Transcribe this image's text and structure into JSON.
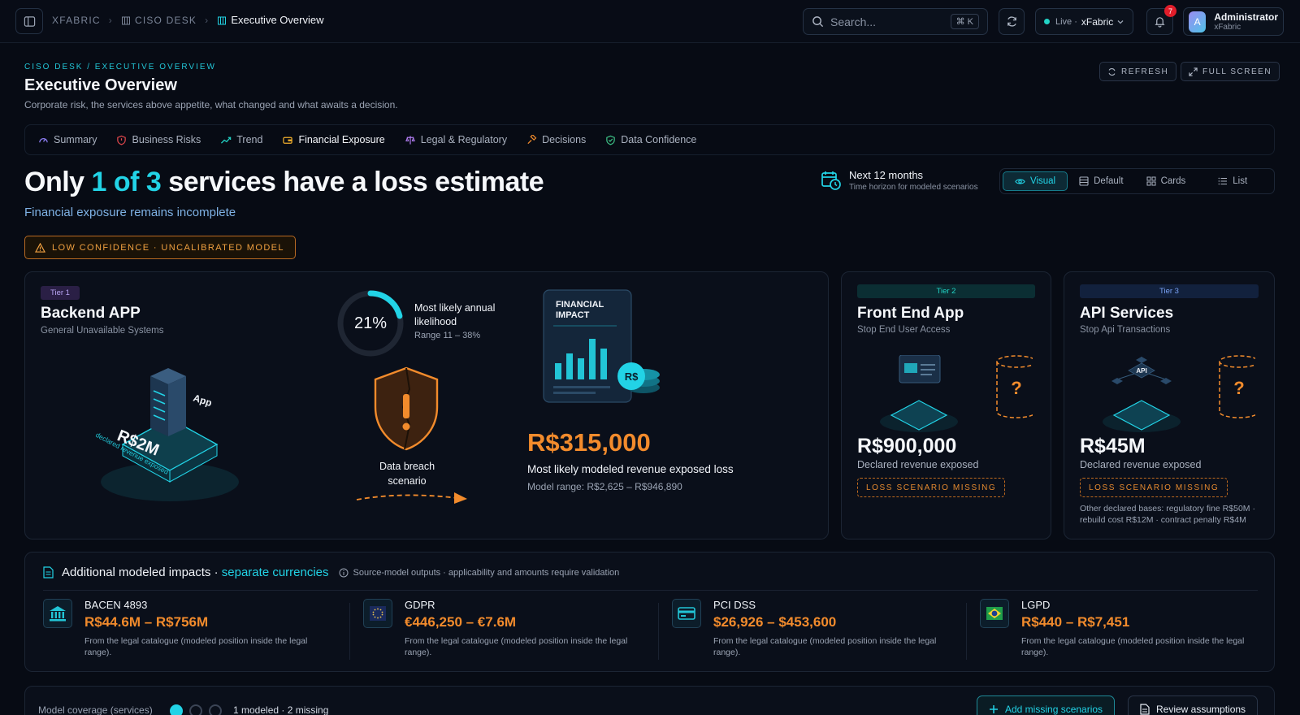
{
  "topbar": {
    "breadcrumbs": [
      "XFABRIC",
      "CISO DESK",
      "Executive Overview"
    ],
    "search_placeholder": "Search...",
    "search_shortcut": "⌘ K",
    "live_label": "Live ·",
    "live_workspace": "xFabric",
    "notification_count": "7",
    "user": {
      "initial": "A",
      "name": "Administrator",
      "org": "xFabric"
    }
  },
  "header": {
    "eyebrow": "CISO DESK / EXECUTIVE OVERVIEW",
    "title": "Executive Overview",
    "subtitle": "Corporate risk, the services above appetite, what changed and what awaits a decision.",
    "refresh_label": "REFRESH",
    "fullscreen_label": "FULL SCREEN"
  },
  "tabs": [
    {
      "label": "Summary",
      "icon": "gauge-icon"
    },
    {
      "label": "Business Risks",
      "icon": "shield-icon"
    },
    {
      "label": "Trend",
      "icon": "trend-icon"
    },
    {
      "label": "Financial Exposure",
      "icon": "wallet-icon",
      "active": true
    },
    {
      "label": "Legal & Regulatory",
      "icon": "scale-icon"
    },
    {
      "label": "Decisions",
      "icon": "gavel-icon"
    },
    {
      "label": "Data Confidence",
      "icon": "shield-check-icon"
    }
  ],
  "hero": {
    "headline_pre": "Only ",
    "headline_highlight": "1 of 3",
    "headline_post": " services have a loss estimate",
    "sublead": "Financial exposure remains incomplete",
    "confidence_label": "LOW CONFIDENCE · UNCALIBRATED MODEL",
    "horizon_title": "Next 12 months",
    "horizon_sub": "Time horizon for modeled scenarios"
  },
  "view_modes": [
    "Visual",
    "Default",
    "Cards",
    "List"
  ],
  "active_view": "Visual",
  "services": {
    "backend": {
      "tier": "Tier 1",
      "title": "Backend APP",
      "subtitle": "General Unavailable Systems",
      "illus_value": "R$2M",
      "illus_caption": "declared revenue exposed",
      "illus_app": "App",
      "likelihood_pct": "21%",
      "likelihood_fraction": 0.21,
      "likelihood_title": "Most likely annual likelihood",
      "likelihood_range": "Range 11 – 38%",
      "scenario_label": "Data breach scenario",
      "fin_label": "FINANCIAL IMPACT",
      "fin_currency": "R$",
      "loss_value": "R$315,000",
      "loss_label": "Most likely modeled revenue exposed loss",
      "model_range": "Model range: R$2,625 – R$946,890"
    },
    "frontend": {
      "tier": "Tier 2",
      "title": "Front End App",
      "subtitle": "Stop End User Access",
      "value": "R$900,000",
      "value_label": "Declared revenue exposed",
      "missing_label": "LOSS SCENARIO MISSING"
    },
    "api": {
      "tier": "Tier 3",
      "title": "API Services",
      "subtitle": "Stop Api Transactions",
      "illus_api": "API",
      "value": "R$45M",
      "value_label": "Declared revenue exposed",
      "missing_label": "LOSS SCENARIO MISSING",
      "note": "Other declared bases: regulatory fine R$50M · rebuild cost R$12M · contract penalty R$4M"
    }
  },
  "impacts": {
    "title": "Additional modeled impacts",
    "separator": " · ",
    "highlight": "separate currencies",
    "note": "Source-model outputs · applicability and amounts require validation",
    "items": [
      {
        "name": "BACEN 4893",
        "range": "R$44.6M – R$756M",
        "desc": "From the legal catalogue (modeled position inside the legal range).",
        "icon": "bank-icon"
      },
      {
        "name": "GDPR",
        "range": "€446,250 – €7.6M",
        "desc": "From the legal catalogue (modeled position inside the legal range).",
        "icon": "eu-flag-icon"
      },
      {
        "name": "PCI DSS",
        "range": "$26,926 – $453,600",
        "desc": "From the legal catalogue (modeled position inside the legal range).",
        "icon": "credit-card-icon"
      },
      {
        "name": "LGPD",
        "range": "R$440 – R$7,451",
        "desc": "From the legal catalogue (modeled position inside the legal range).",
        "icon": "brazil-flag-icon"
      }
    ]
  },
  "coverage": {
    "label": "Model coverage (services)",
    "modeled": 1,
    "total": 3,
    "count_text": "1 modeled · 2 missing",
    "add_label": "Add missing scenarios",
    "review_label": "Review assumptions"
  },
  "colors": {
    "accent": "#22d3e6",
    "warning": "#f28b2c",
    "background": "#070b14",
    "card": "#0a0f1a"
  }
}
